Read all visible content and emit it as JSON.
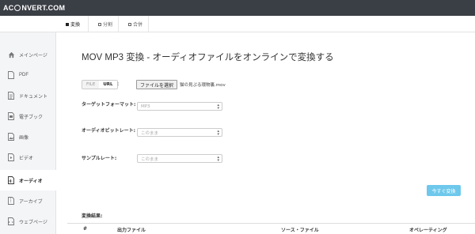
{
  "app": {
    "logo_left": "AC",
    "logo_right": "NVERT.COM"
  },
  "tabs": [
    {
      "label": "変換",
      "active": true
    },
    {
      "label": "分割",
      "active": false
    },
    {
      "label": "合併",
      "active": false
    }
  ],
  "sidebar": {
    "items": [
      {
        "label": "メインページ",
        "icon": "home-icon",
        "active": false
      },
      {
        "label": "PDF",
        "icon": "pdf-file-icon",
        "active": false
      },
      {
        "label": "ドキュメント",
        "icon": "document-icon",
        "active": false
      },
      {
        "label": "電子ブック",
        "icon": "ebook-icon",
        "active": false
      },
      {
        "label": "画像",
        "icon": "image-icon",
        "active": false
      },
      {
        "label": "ビデオ",
        "icon": "video-icon",
        "active": false
      },
      {
        "label": "オーディオ",
        "icon": "audio-file-icon",
        "active": true
      },
      {
        "label": "アーカイブ",
        "icon": "archive-icon",
        "active": false
      },
      {
        "label": "ウェブページ",
        "icon": "webpage-icon",
        "active": false
      }
    ]
  },
  "main": {
    "title": "MOV MP3 変換 - オーディオファイルをオンラインで変換する",
    "source_toggle": {
      "file": "FILE",
      "url": "URL",
      "colon": ":"
    },
    "file_button": "ファイルを選択",
    "file_name": "猫の見ぷる環物裏.mov",
    "form": {
      "target_format": {
        "label": "ターゲットフォーマット:",
        "value": "MP3"
      },
      "audio_bitrate": {
        "label": "オーディオビットレート:",
        "value": "このまま"
      },
      "sample_rate": {
        "label": "サンプルレート:",
        "value": "このまま"
      }
    },
    "convert_button": "今すぐ変換",
    "results": {
      "label": "変換結果:",
      "columns": [
        "#",
        "出力ファイル",
        "ソース・ファイル",
        "オペレーティング"
      ]
    }
  }
}
